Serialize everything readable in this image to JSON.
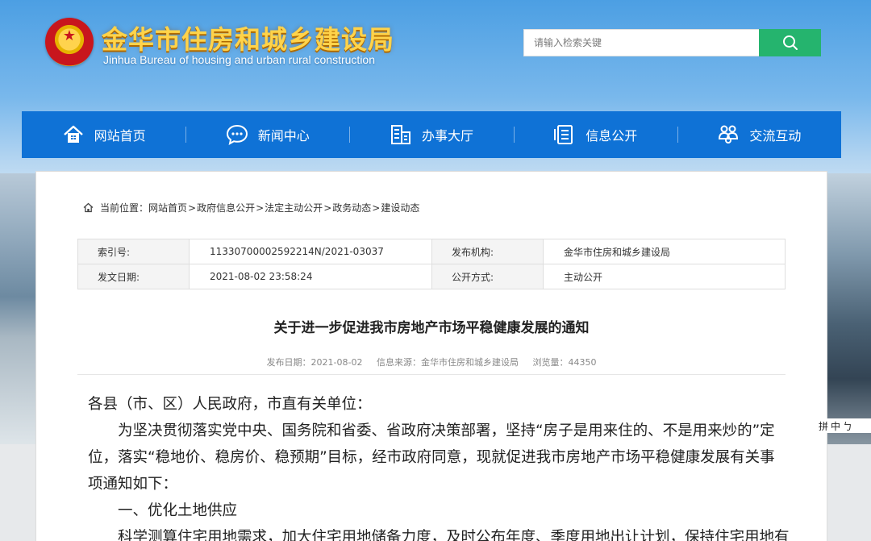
{
  "header": {
    "title": "金华市住房和城乡建设局",
    "subtitle": "Jinhua Bureau of housing and urban rural construction",
    "search_placeholder": "请输入检索关键",
    "search_icon": "search-icon"
  },
  "nav": {
    "items": [
      {
        "label": "网站首页",
        "icon": "home-icon"
      },
      {
        "label": "新闻中心",
        "icon": "chat-bubble-icon"
      },
      {
        "label": "办事大厅",
        "icon": "office-icon"
      },
      {
        "label": "信息公开",
        "icon": "document-icon"
      },
      {
        "label": "交流互动",
        "icon": "people-icon"
      }
    ]
  },
  "breadcrumb": {
    "prefix": "当前位置：",
    "items": [
      "网站首页",
      "政府信息公开",
      "法定主动公开",
      "政务动态",
      "建设动态"
    ],
    "separator": ">"
  },
  "meta": {
    "index_label": "索引号:",
    "index_value": "11330700002592214N/2021-03037",
    "publisher_label": "发布机构:",
    "publisher_value": "金华市住房和城乡建设局",
    "date_label": "发文日期:",
    "date_value": "2021-08-02 23:58:24",
    "mode_label": "公开方式:",
    "mode_value": "主动公开"
  },
  "article": {
    "title": "关于进一步促进我市房地产市场平稳健康发展的通知",
    "publish_date": "发布日期：2021-08-02",
    "source": "信息来源：金华市住房和城乡建设局",
    "views": "浏览量：44350",
    "paragraphs": [
      "各县（市、区）人民政府，市直有关单位：",
      "为坚决贯彻落实党中央、国务院和省委、省政府决策部署，坚持“房子是用来住的、不是用来炒的”定位，落实“稳地价、稳房价、稳预期”目标，经市政府同意，现就促进我市房地产市场平稳健康发展有关事项通知如下：",
      "一、优化土地供应",
      "科学测算住宅用地需求，加大住宅用地储备力度，及时公布年度、季度用地出让计划，保持住宅用地有"
    ]
  },
  "float_tool": {
    "label1": "拼",
    "label2": "中",
    "label3": "ㄅ"
  },
  "colors": {
    "nav_bg": "#0f72d6",
    "search_btn": "#25b46e",
    "title_gold": "#ffd34a"
  }
}
